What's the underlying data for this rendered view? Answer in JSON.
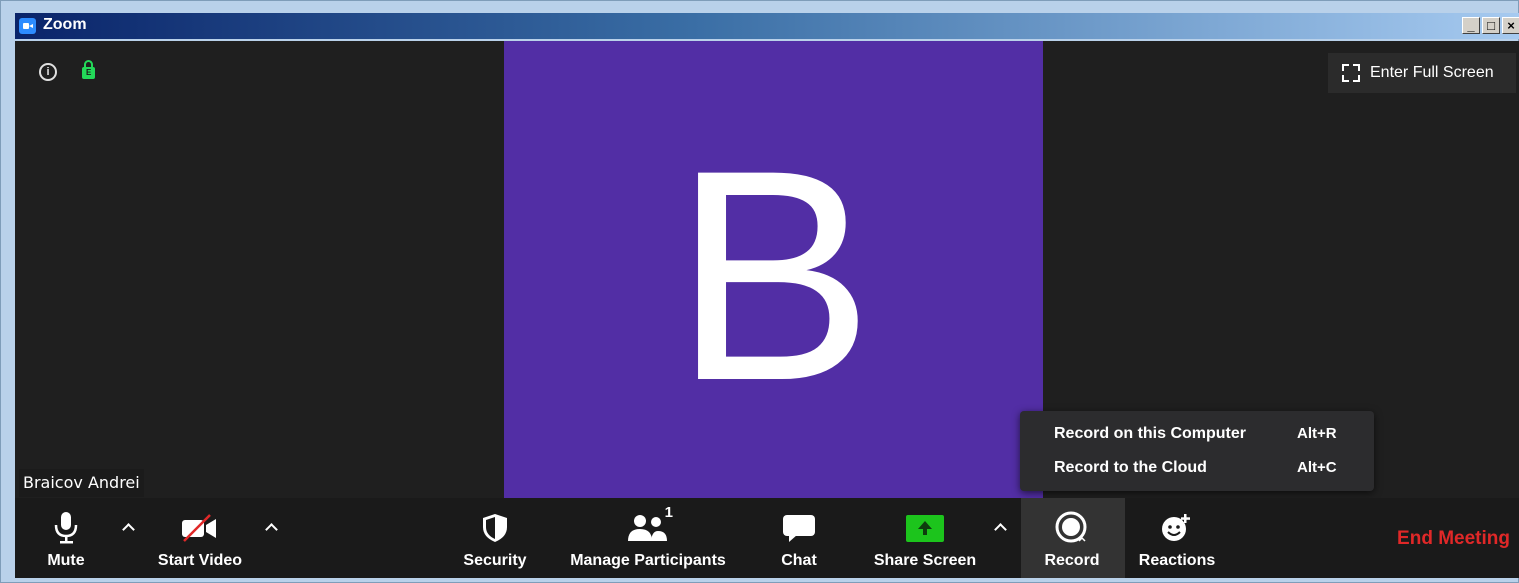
{
  "window": {
    "title": "Zoom",
    "min": "_",
    "max": "□",
    "close": "×"
  },
  "header": {
    "fullscreen_label": "Enter Full Screen",
    "lock_letter": "E",
    "info_glyph": "i"
  },
  "participant": {
    "initial": "B",
    "name": "Braicov Andrei",
    "avatar_color": "#522ea5"
  },
  "record_menu": [
    {
      "label": "Record on this Computer",
      "shortcut": "Alt+R"
    },
    {
      "label": "Record to the Cloud",
      "shortcut": "Alt+C"
    }
  ],
  "toolbar": {
    "mute": "Mute",
    "start_video": "Start Video",
    "security": "Security",
    "manage_participants": "Manage Participants",
    "participant_count": "1",
    "chat": "Chat",
    "share_screen": "Share Screen",
    "record": "Record",
    "reactions": "Reactions",
    "end_meeting": "End Meeting"
  },
  "colors": {
    "end_meeting": "#e02828",
    "share_green": "#1cc41c",
    "lock_green": "#23d959"
  }
}
